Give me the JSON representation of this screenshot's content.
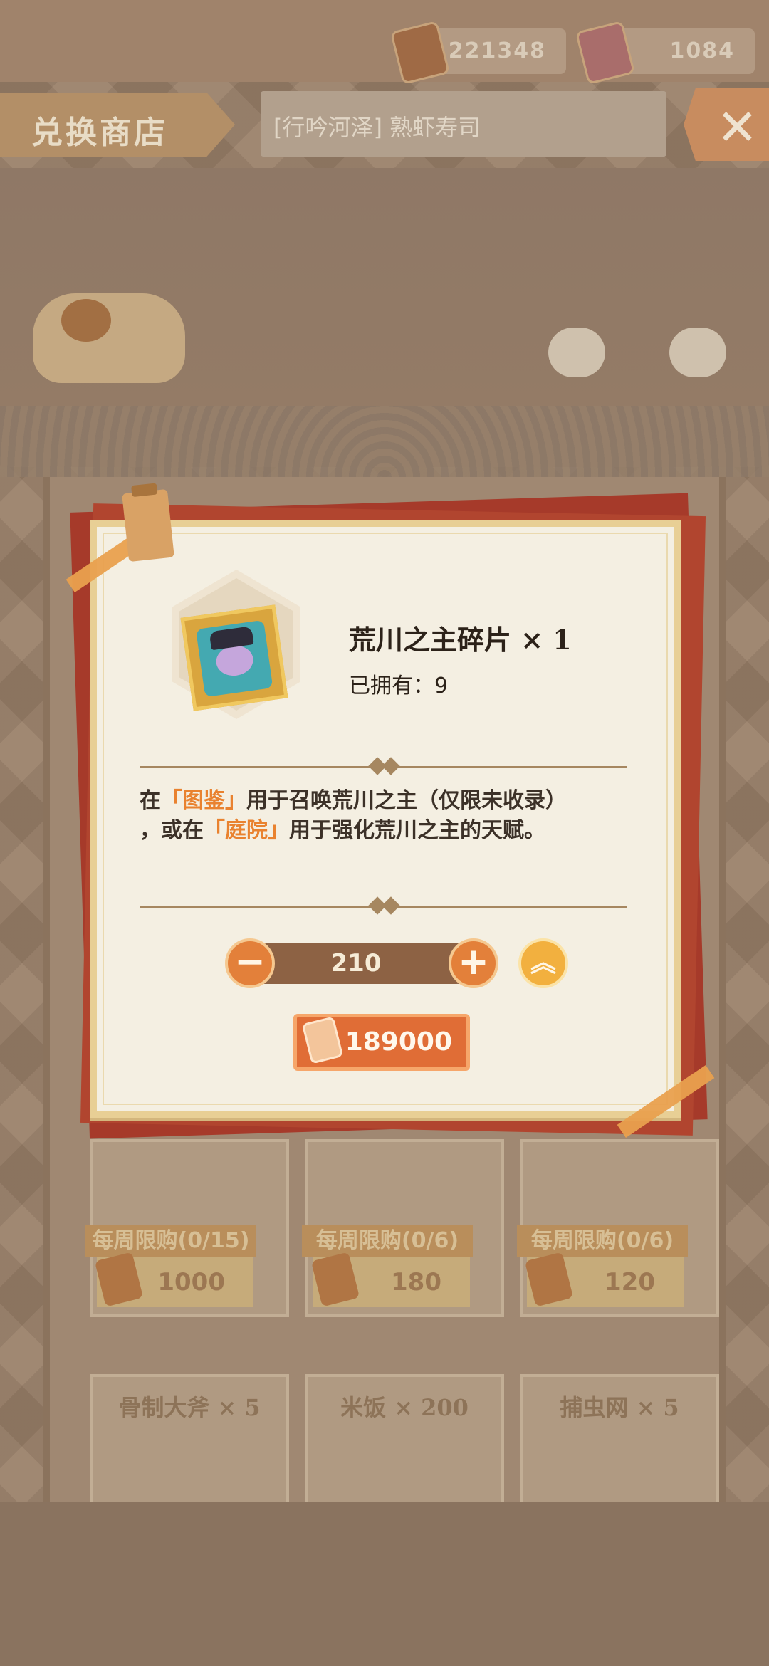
{
  "header": {
    "currency_1": "221348",
    "currency_2": "1084",
    "shop_title": "兑换商店",
    "search_text": "[行吟河泽] 熟虾寿司",
    "close_glyph": "✕"
  },
  "modal": {
    "item_name": "荒川之主碎片 × 1",
    "owned_label": "已拥有：9",
    "desc": {
      "p1": "在",
      "hl1": "「图鉴」",
      "p2": "用于召唤荒川之主（仅限未收录）",
      "p3": "，或在",
      "hl2": "「庭院」",
      "p4": "用于强化荒川之主的天赋。"
    },
    "quantity": "210",
    "minus_glyph": "−",
    "plus_glyph": "+",
    "max_glyph": "︽",
    "price": "189000",
    "icons": [
      "frame-icon",
      "amulet-leaf-icon"
    ]
  },
  "shop_items_row1": [
    {
      "limit": "每周限购(0/15)",
      "price": "1000"
    },
    {
      "limit": "每周限购(0/6)",
      "price": "180"
    },
    {
      "limit": "每周限购(0/6)",
      "price": "120"
    }
  ],
  "shop_items_row2": [
    {
      "label": "骨制大斧 × 5"
    },
    {
      "label": "米饭 × 200"
    },
    {
      "label": "捕虫网 × 5"
    }
  ],
  "colors": {
    "accent_orange": "#e06d36",
    "highlight": "#e9822f",
    "modal_bg": "#f4efe2",
    "backing_red": "#a63a2a"
  }
}
